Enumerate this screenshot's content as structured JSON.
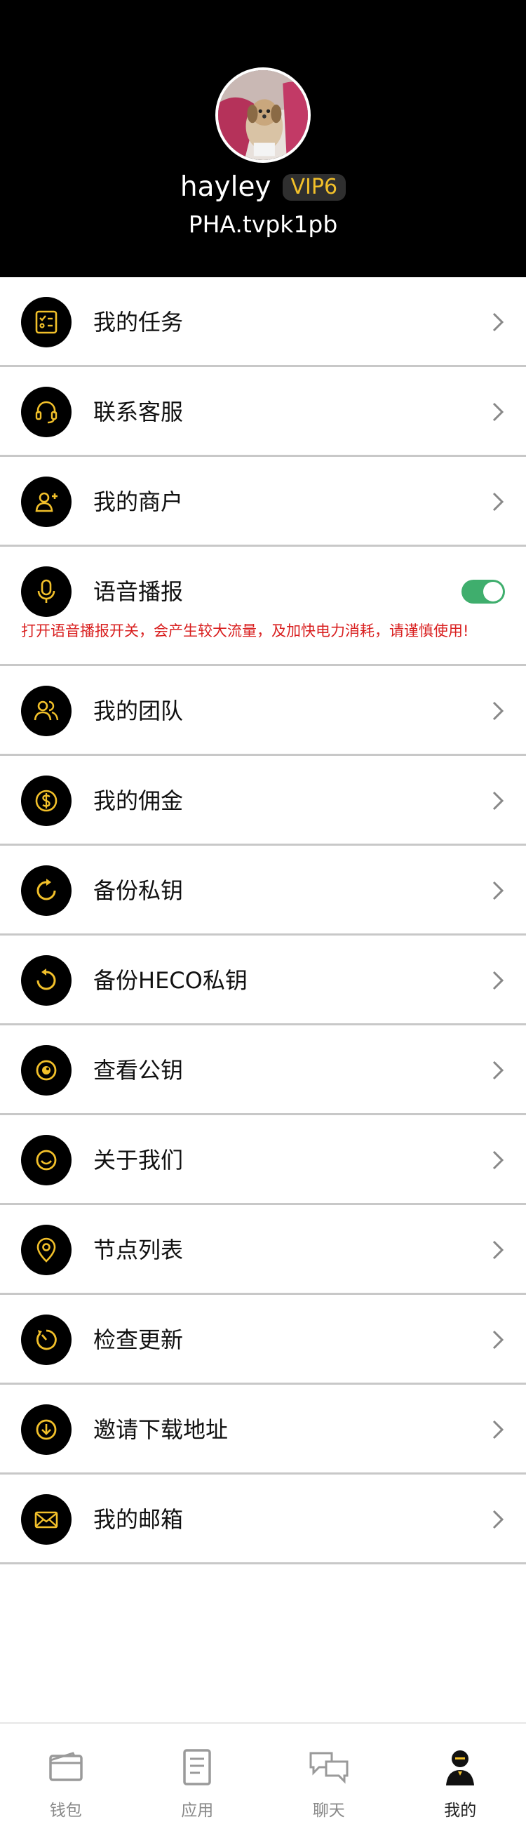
{
  "profile": {
    "username": "hayley",
    "vip_badge": "VIP6",
    "address": "PHA.tvpk1pb"
  },
  "menu": {
    "items": [
      {
        "label": "我的任务",
        "icon": "task-list-icon"
      },
      {
        "label": "联系客服",
        "icon": "headset-icon"
      },
      {
        "label": "我的商户",
        "icon": "add-user-icon"
      },
      {
        "label": "语音播报",
        "icon": "microphone-icon",
        "toggle_on": true,
        "warning": "打开语音播报开关，会产生较大流量，及加快电力消耗，请谨慎使用!"
      },
      {
        "label": "我的团队",
        "icon": "team-icon"
      },
      {
        "label": "我的佣金",
        "icon": "dollar-coin-icon"
      },
      {
        "label": "备份私钥",
        "icon": "refresh-circle-icon"
      },
      {
        "label": "备份HECO私钥",
        "icon": "refresh-circle-icon"
      },
      {
        "label": "查看公钥",
        "icon": "eye-circle-icon"
      },
      {
        "label": "关于我们",
        "icon": "smile-icon"
      },
      {
        "label": "节点列表",
        "icon": "location-pin-icon"
      },
      {
        "label": "检查更新",
        "icon": "clock-update-icon"
      },
      {
        "label": "邀请下载地址",
        "icon": "download-circle-icon"
      },
      {
        "label": "我的邮箱",
        "icon": "envelope-icon"
      }
    ]
  },
  "tabbar": {
    "tabs": [
      {
        "label": "钱包",
        "icon": "wallet-icon"
      },
      {
        "label": "应用",
        "icon": "document-icon"
      },
      {
        "label": "聊天",
        "icon": "chat-bubbles-icon"
      },
      {
        "label": "我的",
        "icon": "profile-person-icon",
        "active": true
      }
    ]
  },
  "colors": {
    "accent": "#F2C02A",
    "header_bg": "#000000",
    "warning_text": "#D92020",
    "toggle_on": "#3FAE6D"
  }
}
